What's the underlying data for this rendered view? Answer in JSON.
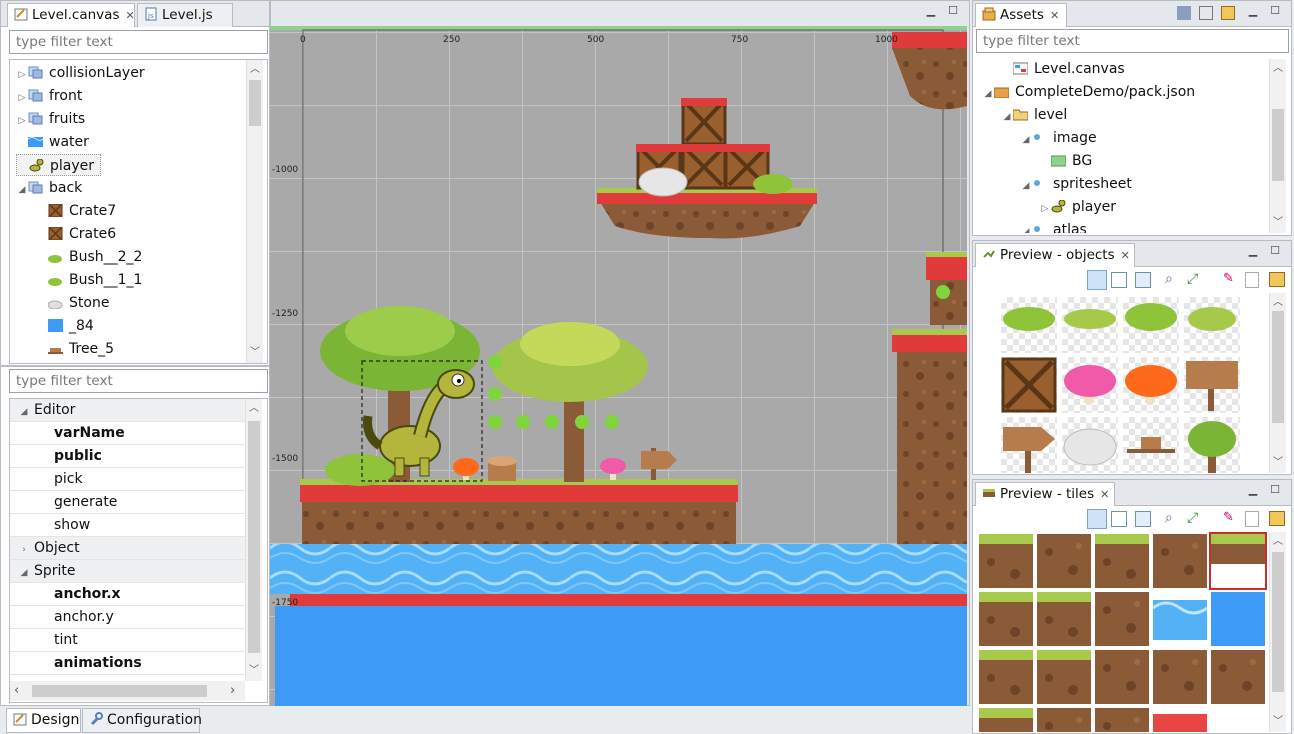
{
  "editor_tabs": [
    {
      "label": "Level.canvas",
      "active": true,
      "closable": true
    },
    {
      "label": "Level.js",
      "active": false,
      "closable": false
    }
  ],
  "outline": {
    "filter_placeholder": "type filter text",
    "items": [
      {
        "label": "collisionLayer",
        "icon": "layer-icon",
        "expander": "collapsed",
        "depth": 0
      },
      {
        "label": "front",
        "icon": "layer-icon",
        "expander": "collapsed",
        "depth": 0
      },
      {
        "label": "fruits",
        "icon": "layer-icon",
        "expander": "collapsed",
        "depth": 0
      },
      {
        "label": "water",
        "icon": "water-icon",
        "expander": "none",
        "depth": 0
      },
      {
        "label": "player",
        "icon": "dino-icon",
        "expander": "none",
        "depth": 0,
        "selected": true
      },
      {
        "label": "back",
        "icon": "layer-icon",
        "expander": "expanded",
        "depth": 0
      },
      {
        "label": "Crate7",
        "icon": "crate-icon",
        "expander": "none",
        "depth": 1
      },
      {
        "label": "Crate6",
        "icon": "crate-icon",
        "expander": "none",
        "depth": 1
      },
      {
        "label": "Bush__2_2",
        "icon": "bush-icon",
        "expander": "none",
        "depth": 1
      },
      {
        "label": "Bush__1_1",
        "icon": "bush-icon",
        "expander": "none",
        "depth": 1
      },
      {
        "label": "Stone",
        "icon": "stone-icon",
        "expander": "none",
        "depth": 1
      },
      {
        "label": "_84",
        "icon": "tile-icon",
        "expander": "none",
        "depth": 1
      },
      {
        "label": "Tree_5",
        "icon": "stump-icon",
        "expander": "none",
        "depth": 1
      }
    ]
  },
  "properties": {
    "filter_placeholder": "type filter text",
    "rows": [
      {
        "label": "Editor",
        "kind": "category",
        "expander": "expanded"
      },
      {
        "label": "varName",
        "kind": "prop",
        "bold": true
      },
      {
        "label": "public",
        "kind": "prop",
        "bold": true
      },
      {
        "label": "pick",
        "kind": "prop",
        "bold": false
      },
      {
        "label": "generate",
        "kind": "prop",
        "bold": false
      },
      {
        "label": "show",
        "kind": "prop",
        "bold": false
      },
      {
        "label": "Object",
        "kind": "category",
        "expander": "collapsed"
      },
      {
        "label": "Sprite",
        "kind": "category",
        "expander": "expanded"
      },
      {
        "label": "anchor.x",
        "kind": "prop",
        "bold": true
      },
      {
        "label": "anchor.y",
        "kind": "prop",
        "bold": false
      },
      {
        "label": "tint",
        "kind": "prop",
        "bold": false
      },
      {
        "label": "animations",
        "kind": "prop",
        "bold": true
      }
    ]
  },
  "bottom_tabs": [
    {
      "label": "Design",
      "active": true
    },
    {
      "label": "Configuration",
      "active": false
    }
  ],
  "canvas": {
    "ruler_x": [
      "0",
      "250",
      "500",
      "750",
      "1000"
    ],
    "ruler_y": [
      "-1000",
      "-1250",
      "-1500",
      "-1750"
    ],
    "background_color": "#a9a9a9",
    "water_color": "#3d9bf5",
    "grass_color": "#e03a3a"
  },
  "assets": {
    "title": "Assets",
    "filter_placeholder": "type filter text",
    "items": [
      {
        "label": "Level.canvas",
        "icon": "canvas-file-icon",
        "expander": "none",
        "depth": 1
      },
      {
        "label": "CompleteDemo/pack.json",
        "icon": "pack-icon",
        "expander": "expanded",
        "depth": 0
      },
      {
        "label": "level",
        "icon": "folder-icon",
        "expander": "expanded",
        "depth": 1
      },
      {
        "label": "image",
        "icon": "dot-icon",
        "expander": "expanded",
        "depth": 2
      },
      {
        "label": "BG",
        "icon": "image-icon",
        "expander": "none",
        "depth": 3
      },
      {
        "label": "spritesheet",
        "icon": "dot-icon",
        "expander": "expanded",
        "depth": 2
      },
      {
        "label": "player",
        "icon": "dino-icon",
        "expander": "collapsed",
        "depth": 3
      },
      {
        "label": "atlas",
        "icon": "dot-icon",
        "expander": "expanded",
        "depth": 2
      }
    ]
  },
  "preview_objects": {
    "title": "Preview - objects",
    "thumbs": [
      "bush-1",
      "bush-2",
      "bush-3",
      "bush-4",
      "crate",
      "mushroom-pink",
      "mushroom-orange",
      "sign-board",
      "arrow-sign",
      "stone",
      "stump",
      "tree"
    ]
  },
  "preview_tiles": {
    "title": "Preview - tiles",
    "thumbs": [
      "grass-top",
      "dirt",
      "grass-edge",
      "dirt-cliff",
      "float-edge-selected",
      "grass-top-2",
      "grass-edge-2",
      "dirt-col",
      "water-wave",
      "water",
      "grass-left",
      "grass-right",
      "dirt-2",
      "dirt-3",
      "dirt-4",
      "grass-small",
      "dirt-5",
      "dirt-6",
      "red-tile"
    ]
  }
}
